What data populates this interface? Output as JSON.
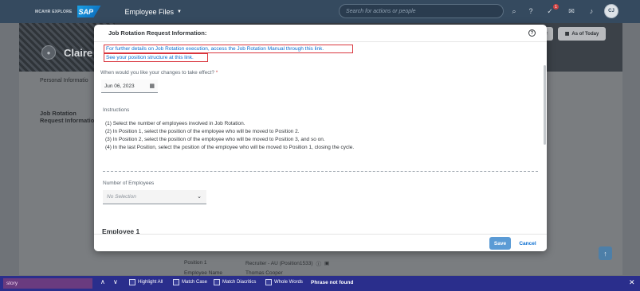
{
  "shell": {
    "brand": "MCAHR EXPLORE",
    "logo": "SAP",
    "app_title": "Employee Files",
    "search_placeholder": "Search for actions or people",
    "notification_count": "1",
    "avatar_initials": "CJ"
  },
  "background": {
    "employee_name": "Claire",
    "tab_label": "Personal Informatio",
    "section_title": "Job Rotation Request Information",
    "as_of_label": "As of Today",
    "row1_label": "Position 1",
    "row1_value": "Recruiter - AU (Position1533)",
    "row2_label": "Employee Name",
    "row2_value": "Thomas Cooper"
  },
  "dialog": {
    "title": "Job Rotation Request Information:",
    "link1": "For further details on Job Rotation execution, access the Job Rotation Manual through this link.",
    "link2": "See your position structure at this link.",
    "effective_label": "When would you like your changes to take effect?",
    "required_mark": "*",
    "date_value": "Jun 06, 2023",
    "instructions_label": "Instructions",
    "instructions": [
      "(1) Select the number of employees involved in Job Rotation.",
      "(2) In Position 1, select the position of the employee who will be moved to Position 2.",
      "(3) In Position 2, select the position of the employee who will be moved to Position 3, and so on.",
      "(4) In the last Position, select the position of the employee who will be moved to Position 1, closing the cycle."
    ],
    "num_employees_label": "Number of Employees",
    "num_employees_placeholder": "No Selection",
    "employee_section": "Employee 1",
    "save_label": "Save",
    "cancel_label": "Cancel"
  },
  "findbar": {
    "query": "story",
    "highlight_all": "Highlight All",
    "match_case": "Match Case",
    "match_diacritics": "Match Diacritics",
    "whole_words": "Whole Words",
    "status": "Phrase not found"
  },
  "colors": {
    "shell_bg": "#354a5f",
    "link": "#0a6ed1",
    "highlight_box": "#d9363e",
    "save_button": "#5b9bd5",
    "findbar_bg": "#2a2e8c"
  }
}
